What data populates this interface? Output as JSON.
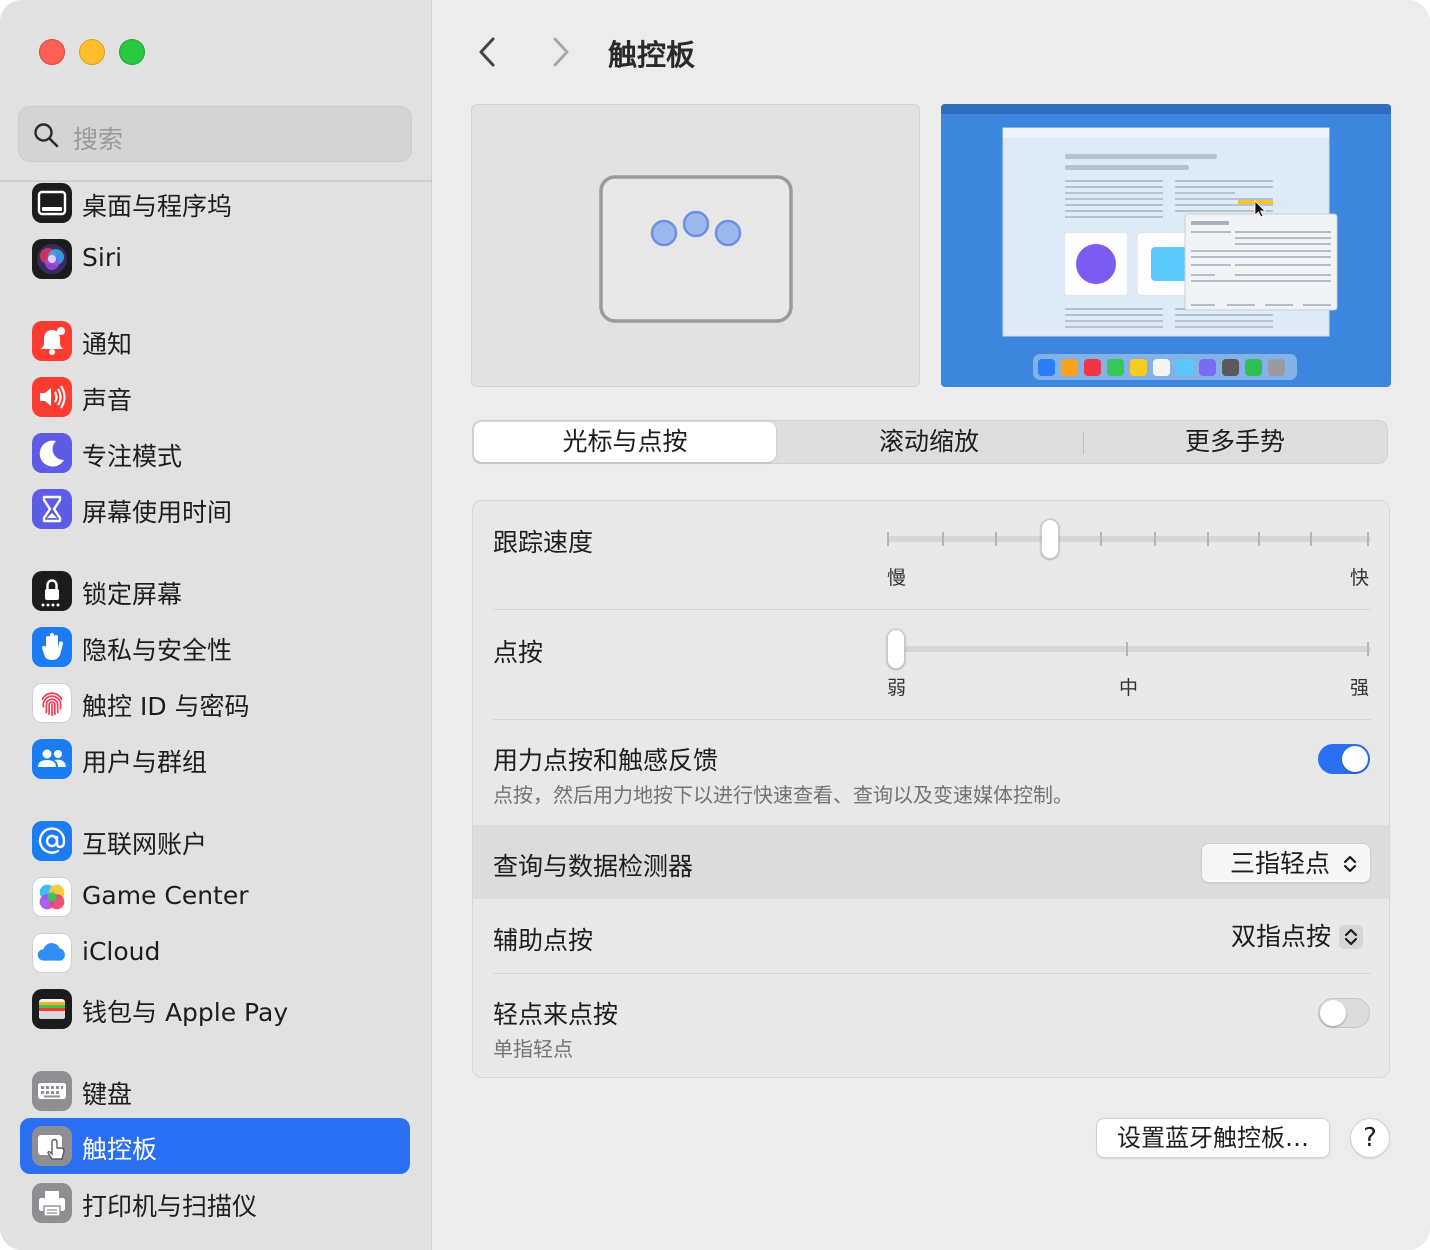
{
  "window": {
    "title": "触控板"
  },
  "sidebar": {
    "search_placeholder": "搜索",
    "items": [
      {
        "label": "桌面与程序坞",
        "icon": "dock-icon",
        "color": "#1c1c1e"
      },
      {
        "label": "Siri",
        "icon": "siri-icon",
        "color": "#1c1c1e"
      },
      {
        "label": "通知",
        "icon": "bell-icon",
        "color": "#fe3b30"
      },
      {
        "label": "声音",
        "icon": "speaker-icon",
        "color": "#fe3b30"
      },
      {
        "label": "专注模式",
        "icon": "moon-icon",
        "color": "#5e5ce6"
      },
      {
        "label": "屏幕使用时间",
        "icon": "hourglass-icon",
        "color": "#5e5ce6"
      },
      {
        "label": "锁定屏幕",
        "icon": "lock-icon",
        "color": "#1c1c1e"
      },
      {
        "label": "隐私与安全性",
        "icon": "hand-icon",
        "color": "#1c7cf4"
      },
      {
        "label": "触控 ID 与密码",
        "icon": "fingerprint-icon",
        "color": "#ffffff"
      },
      {
        "label": "用户与群组",
        "icon": "users-icon",
        "color": "#1c7cf4"
      },
      {
        "label": "互联网账户",
        "icon": "at-icon",
        "color": "#1c7cf4"
      },
      {
        "label": "Game Center",
        "icon": "game-center-icon",
        "color": "#ffffff"
      },
      {
        "label": "iCloud",
        "icon": "cloud-icon",
        "color": "#ffffff"
      },
      {
        "label": "钱包与 Apple Pay",
        "icon": "wallet-icon",
        "color": "#1c1c1e"
      },
      {
        "label": "键盘",
        "icon": "keyboard-icon",
        "color": "#8e8e93"
      },
      {
        "label": "触控板",
        "icon": "trackpad-icon",
        "color": "#8e8e93",
        "active": true
      },
      {
        "label": "打印机与扫描仪",
        "icon": "printer-icon",
        "color": "#8e8e93"
      }
    ]
  },
  "main": {
    "title": "触控板",
    "tabs": [
      {
        "label": "光标与点按",
        "selected": true
      },
      {
        "label": "滚动缩放",
        "selected": false
      },
      {
        "label": "更多手势",
        "selected": false
      }
    ],
    "tracking": {
      "label": "跟踪速度",
      "min_label": "慢",
      "max_label": "快",
      "value_fraction": 0.33,
      "ticks": 10
    },
    "click": {
      "label": "点按",
      "labels": [
        "弱",
        "中",
        "强"
      ],
      "value_fraction": 0.0,
      "ticks": 3
    },
    "force_click": {
      "label": "用力点按和触感反馈",
      "desc": "点按，然后用力地按下以进行快速查看、查询以及变速媒体控制。",
      "on": true
    },
    "lookup": {
      "label": "查询与数据检测器",
      "value": "三指轻点"
    },
    "secondary": {
      "label": "辅助点按",
      "value": "双指点按"
    },
    "tap_to_click": {
      "label": "轻点来点按",
      "desc": "单指轻点",
      "on": false
    },
    "setup_button": "设置蓝牙触控板…",
    "help_button": "?"
  },
  "colors": {
    "accent": "#2a6ff1",
    "sidebar_bg": "#e1e1e1"
  }
}
